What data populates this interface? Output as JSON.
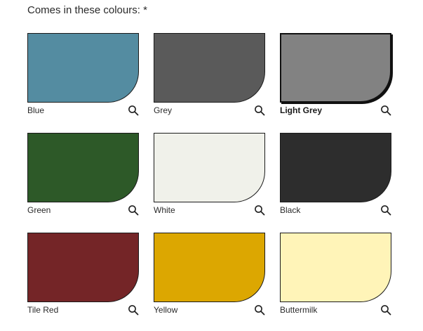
{
  "section": {
    "heading": "Comes in these colours: *"
  },
  "colours": [
    {
      "name": "Blue",
      "hex": "#548ca1",
      "selected": false
    },
    {
      "name": "Grey",
      "hex": "#5a5a5a",
      "selected": false
    },
    {
      "name": "Light Grey",
      "hex": "#828282",
      "selected": true
    },
    {
      "name": "Green",
      "hex": "#2d5928",
      "selected": false
    },
    {
      "name": "White",
      "hex": "#f0f1ea",
      "selected": false
    },
    {
      "name": "Black",
      "hex": "#2d2d2d",
      "selected": false
    },
    {
      "name": "Tile Red",
      "hex": "#742527",
      "selected": false
    },
    {
      "name": "Yellow",
      "hex": "#dca701",
      "selected": false
    },
    {
      "name": "Buttermilk",
      "hex": "#fff4b8",
      "selected": false
    }
  ],
  "icons": {
    "zoom": "magnifier-icon"
  }
}
